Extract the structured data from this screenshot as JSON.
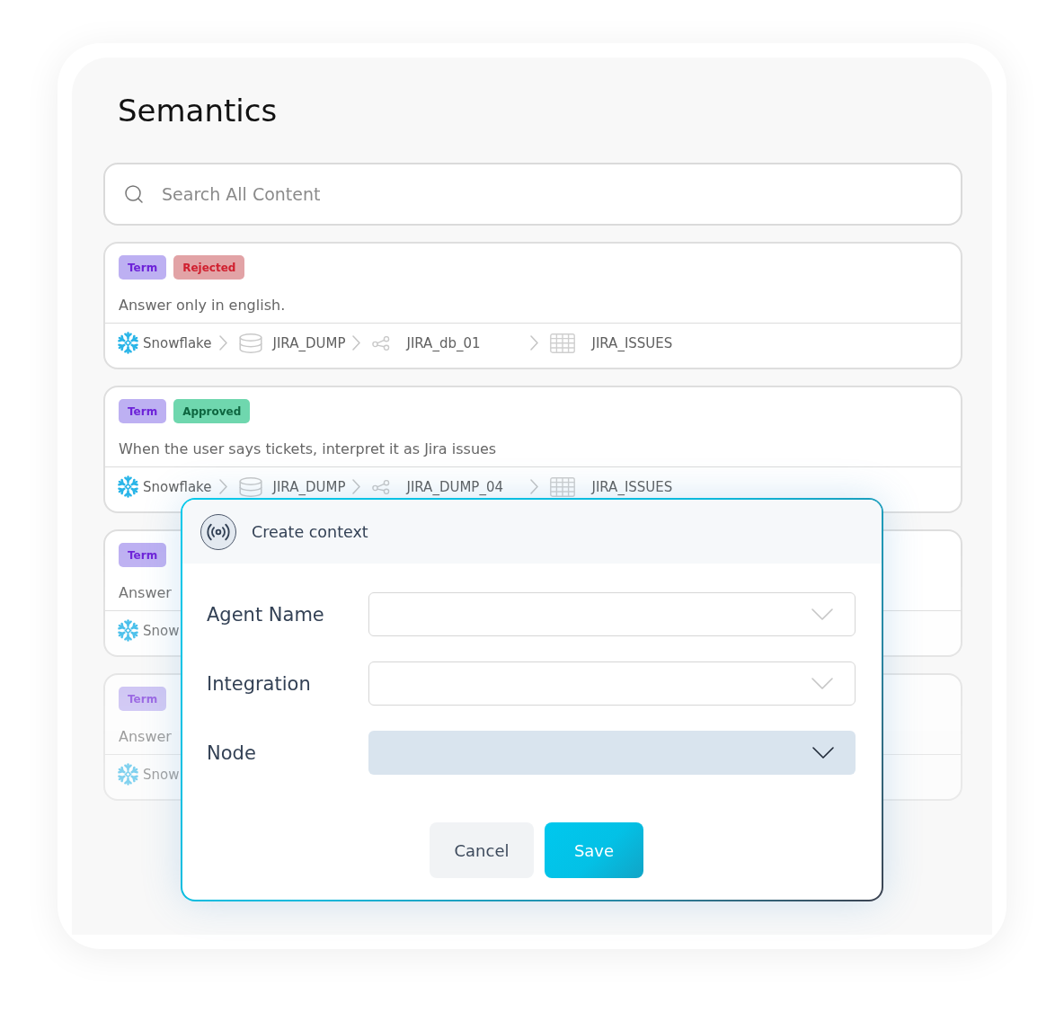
{
  "page": {
    "title": "Semantics"
  },
  "search": {
    "placeholder": "Search All Content"
  },
  "cards": [
    {
      "badges": [
        {
          "label": "Term",
          "kind": "term"
        },
        {
          "label": "Rejected",
          "kind": "rejected"
        }
      ],
      "text": "Answer only in english.",
      "path": [
        {
          "kind": "warehouse",
          "label": "Snowflake"
        },
        {
          "kind": "database",
          "label": "JIRA_DUMP"
        },
        {
          "kind": "schema",
          "label": "JIRA_db_01"
        },
        {
          "kind": "table",
          "label": "JIRA_ISSUES"
        }
      ]
    },
    {
      "badges": [
        {
          "label": "Term",
          "kind": "term"
        },
        {
          "label": "Approved",
          "kind": "approved"
        }
      ],
      "text": "When the user says tickets, interpret it as Jira issues",
      "path": [
        {
          "kind": "warehouse",
          "label": "Snowflake"
        },
        {
          "kind": "database",
          "label": "JIRA_DUMP"
        },
        {
          "kind": "schema",
          "label": "JIRA_DUMP_04"
        },
        {
          "kind": "table",
          "label": "JIRA_ISSUES"
        }
      ]
    },
    {
      "badges": [
        {
          "label": "Term",
          "kind": "term"
        }
      ],
      "text": "Answer",
      "path": [
        {
          "kind": "warehouse",
          "label": "Snow"
        }
      ]
    },
    {
      "badges": [
        {
          "label": "Term",
          "kind": "term"
        }
      ],
      "text": "Answer",
      "path": [
        {
          "kind": "warehouse",
          "label": "Snow"
        }
      ]
    }
  ],
  "dialog": {
    "title": "Create context",
    "fields": [
      {
        "label": "Agent Name",
        "kind": "select",
        "focused": false
      },
      {
        "label": "Integration",
        "kind": "select",
        "focused": false
      },
      {
        "label": "Node",
        "kind": "select",
        "focused": true
      }
    ],
    "buttons": [
      {
        "label": "Cancel",
        "kind": "secondary"
      },
      {
        "label": "Save",
        "kind": "primary"
      }
    ]
  }
}
